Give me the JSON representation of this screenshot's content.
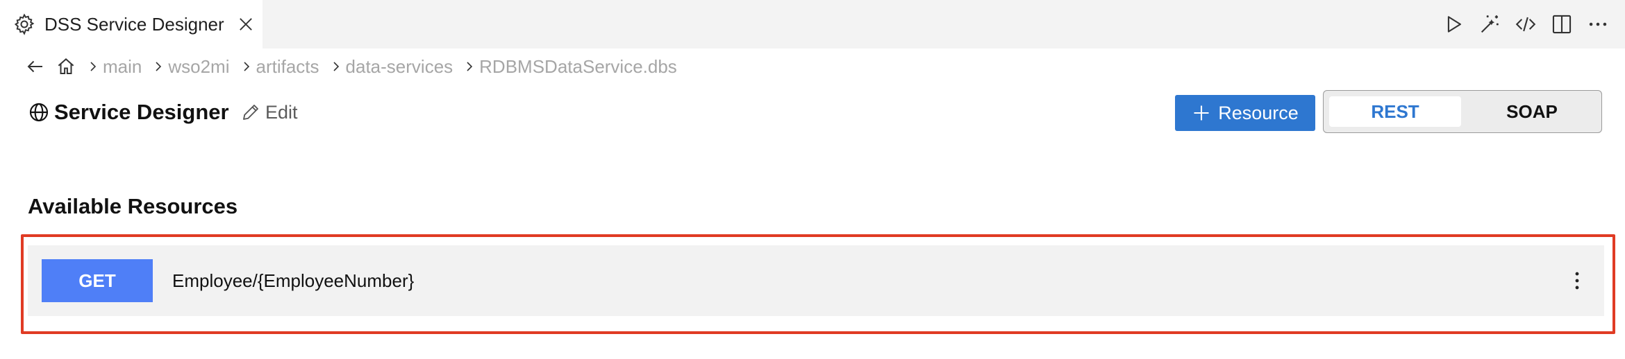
{
  "tab": {
    "title": "DSS Service Designer",
    "icon": "gear-icon"
  },
  "toolbar": {
    "icons": [
      "run-icon",
      "magic-wand-icon",
      "code-icon",
      "split-editor-icon",
      "more-icon"
    ]
  },
  "breadcrumb": {
    "items": [
      "main",
      "wso2mi",
      "artifacts",
      "data-services",
      "RDBMSDataService.dbs"
    ]
  },
  "header": {
    "title": "Service Designer",
    "edit_label": "Edit",
    "add_resource_label": "Resource",
    "modes": {
      "rest": "REST",
      "soap": "SOAP",
      "selected": "REST"
    }
  },
  "resources": {
    "section_title": "Available Resources",
    "items": [
      {
        "method": "GET",
        "path": "Employee/{EmployeeNumber}"
      }
    ]
  },
  "colors": {
    "accent": "#2e77d0",
    "method_get": "#4f7ff7",
    "highlight": "#e03b24"
  }
}
